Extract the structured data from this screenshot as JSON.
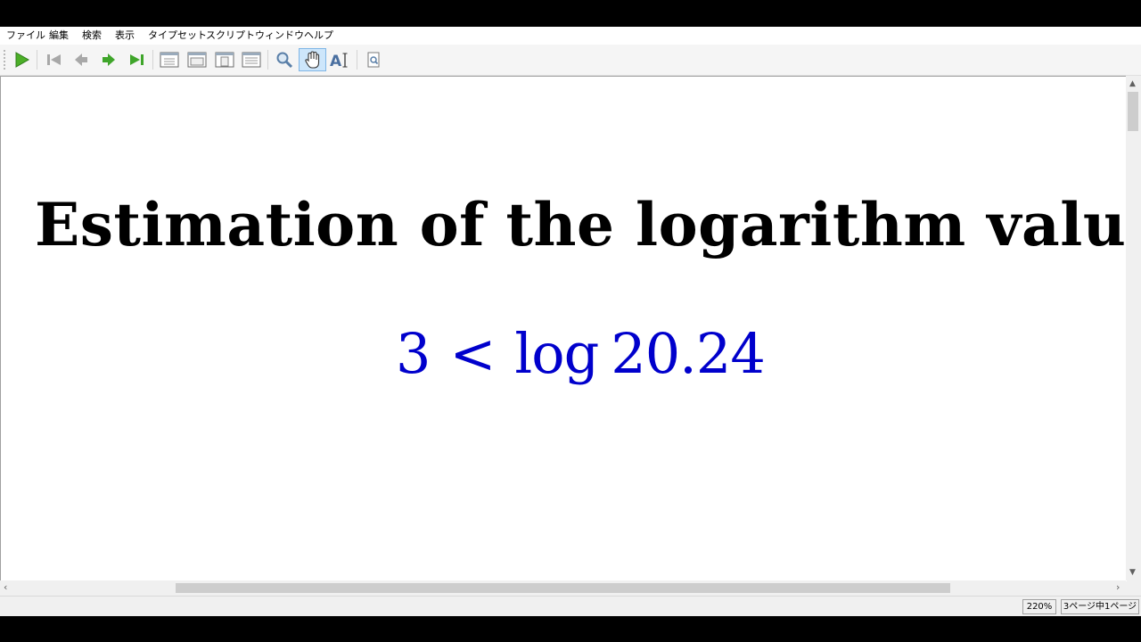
{
  "menu": {
    "file": "ファイル",
    "edit": "編集",
    "search": "検索",
    "view": "表示",
    "typeset": "タイプセット",
    "script": "スクリプト",
    "window": "ウィンドウ",
    "help": "ヘルプ"
  },
  "toolbar": {
    "icons": [
      "play-icon",
      "first-page-icon",
      "previous-page-icon",
      "next-page-icon",
      "last-page-icon",
      "fit-actual-size-icon",
      "fit-width-icon",
      "fit-window-icon",
      "fit-page-icon",
      "magnifier-icon",
      "hand-tool-icon",
      "text-select-icon",
      "find-icon"
    ],
    "active_tool": "hand-tool-icon"
  },
  "document": {
    "title": "Estimation of the logarithm value",
    "formula_left": "3",
    "formula_op": "<",
    "formula_log": "log",
    "formula_arg": "20.24",
    "formula_color": "#0000cc"
  },
  "status": {
    "zoom": "220%",
    "page": "3ページ中1ページ"
  },
  "colors": {
    "accent_green": "#4caf28",
    "toolbar_active": "#cde6fb"
  }
}
